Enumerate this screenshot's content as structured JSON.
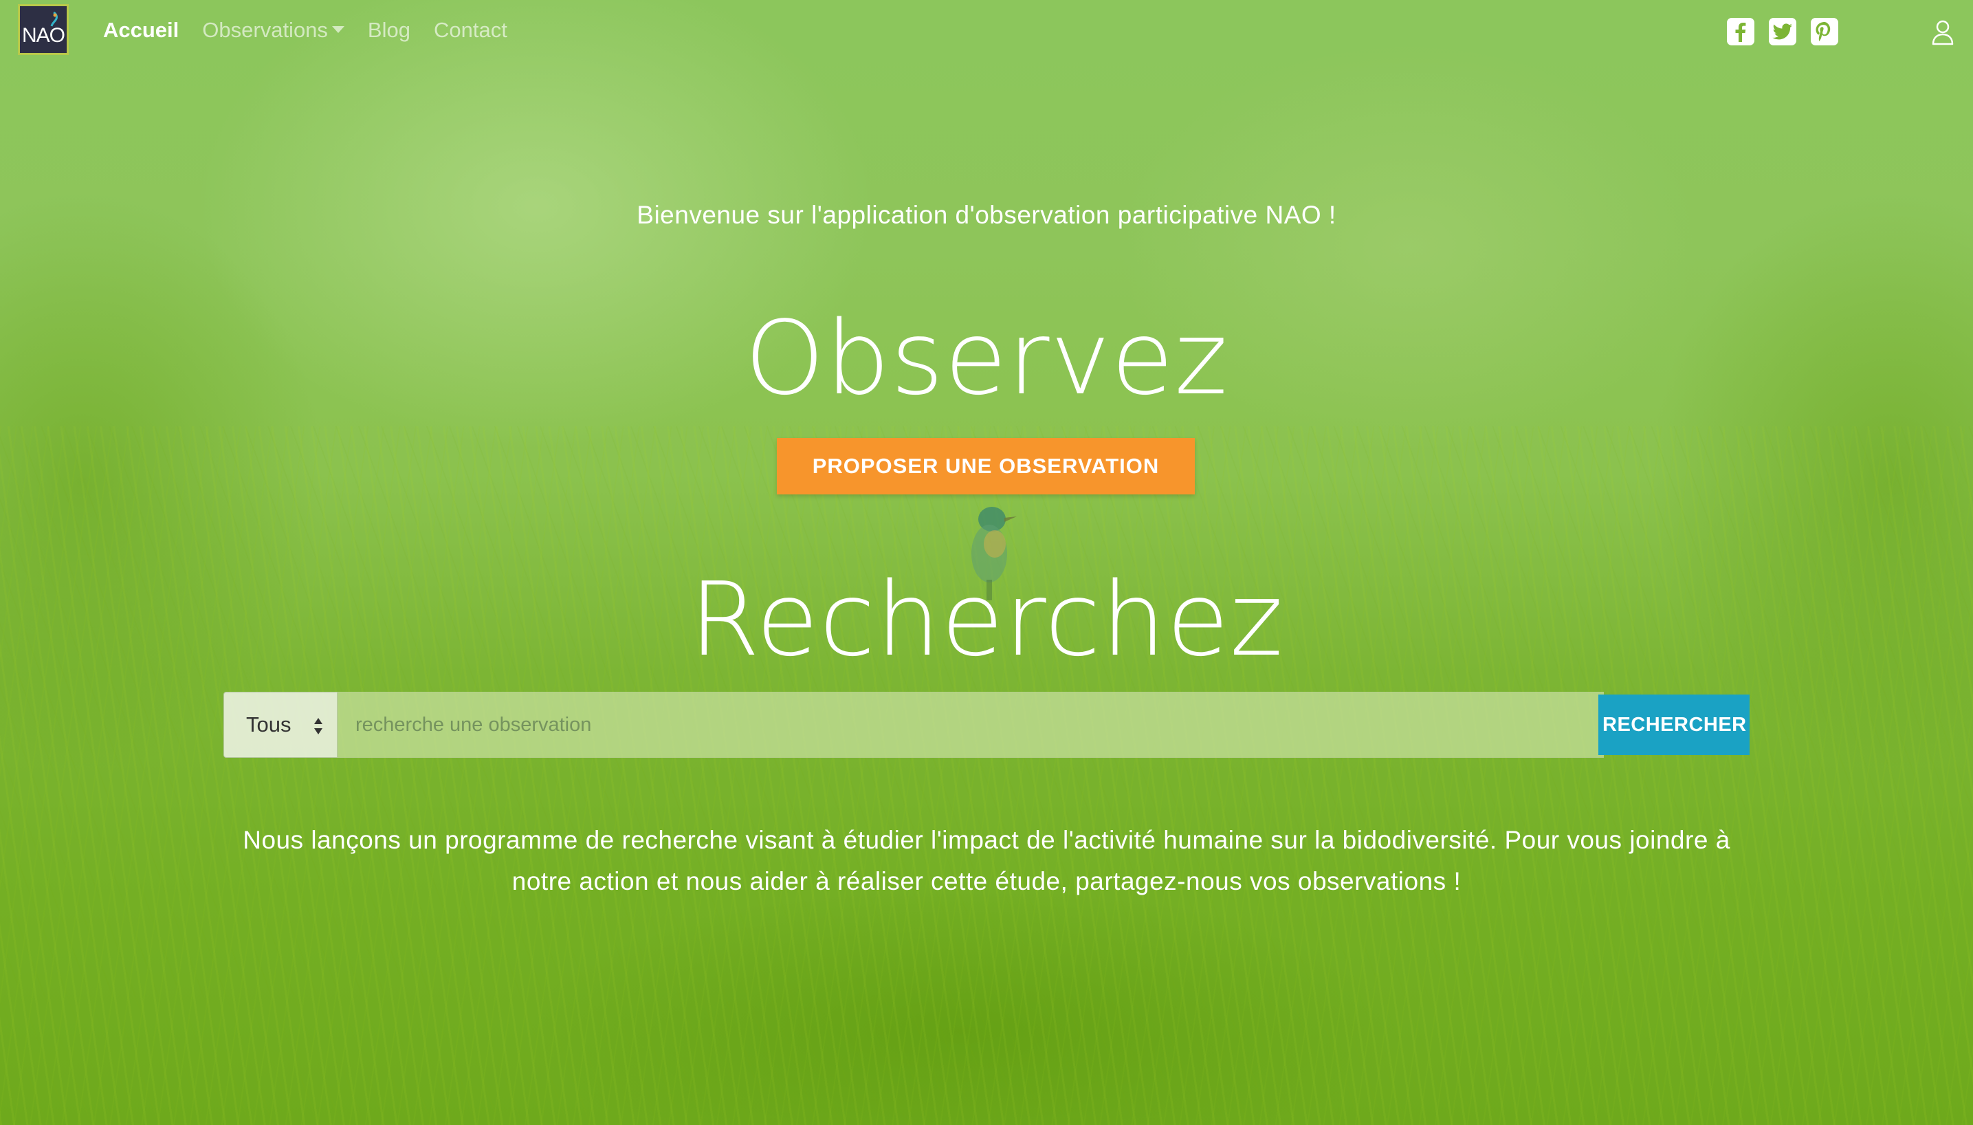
{
  "colors": {
    "accent_orange": "#f7952c",
    "accent_blue": "#1aa2c4",
    "hero_green": "#7cb534",
    "logo_bg": "#2d2f44"
  },
  "brand": {
    "logo_text": "NAO"
  },
  "nav": {
    "items": [
      {
        "label": "Accueil",
        "active": true
      },
      {
        "label": "Observations",
        "dropdown": true
      },
      {
        "label": "Blog"
      },
      {
        "label": "Contact"
      }
    ],
    "social": [
      {
        "icon": "facebook-icon"
      },
      {
        "icon": "twitter-icon"
      },
      {
        "icon": "pinterest-icon"
      }
    ],
    "user_icon": "user-icon"
  },
  "hero": {
    "welcome": "Bienvenue sur l'application d'observation participative NAO !",
    "title_observe": "Observez",
    "cta_label": "PROPOSER UNE OBSERVATION",
    "title_search": "Recherchez"
  },
  "search": {
    "select_value": "Tous",
    "placeholder": "recherche une observation",
    "value": "",
    "button_label": "RECHERCHER"
  },
  "intro": {
    "text": "Nous lançons un programme de recherche visant à étudier l'impact de l'activité humaine sur la bidodiversité. Pour vous joindre à notre action et nous aider à réaliser cette étude, partagez-nous vos observations !"
  }
}
